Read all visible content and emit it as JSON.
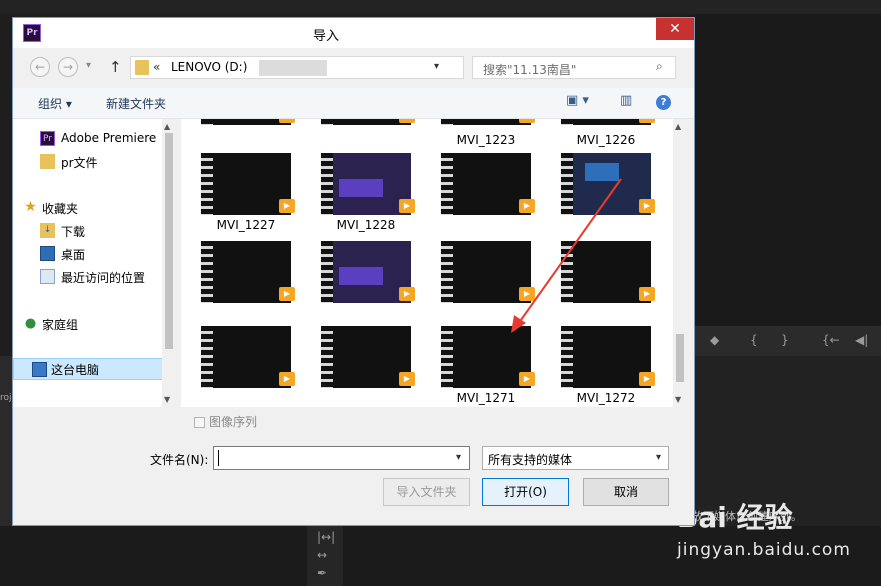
{
  "dialog": {
    "title": "导入",
    "app_icon": "Pr",
    "close_glyph": "✕"
  },
  "nav": {
    "back_glyph": "←",
    "forward_glyph": "→",
    "up_glyph": "↑",
    "address_prefix": "«",
    "address_path": "LENOVO (D:)",
    "search_placeholder": "搜索\"11.13南昌\""
  },
  "toolbar": {
    "organize_label": "组织 ▾",
    "new_folder_label": "新建文件夹"
  },
  "sidebar": {
    "items": [
      {
        "label": "Adobe Premiere",
        "icon": "premiere-icon"
      },
      {
        "label": "pr文件",
        "icon": "folder-icon"
      },
      {
        "label": "收藏夹",
        "icon": "star-icon"
      },
      {
        "label": "下载",
        "icon": "download-folder-icon"
      },
      {
        "label": "桌面",
        "icon": "desktop-icon"
      },
      {
        "label": "最近访问的位置",
        "icon": "recent-places-icon"
      },
      {
        "label": "家庭组",
        "icon": "homegroup-icon"
      },
      {
        "label": "这台电脑",
        "icon": "computer-icon"
      }
    ]
  },
  "files": {
    "row0_labels": [
      "MVI_1223",
      "MVI_1226"
    ],
    "tiles": [
      {
        "name": "MVI_1227"
      },
      {
        "name": "MVI_1228"
      },
      {
        "name": ""
      },
      {
        "name": ""
      },
      {
        "name": ""
      },
      {
        "name": ""
      },
      {
        "name": ""
      },
      {
        "name": ""
      },
      {
        "name": ""
      },
      {
        "name": ""
      },
      {
        "name": "MVI_1271"
      },
      {
        "name": "MVI_1272"
      }
    ]
  },
  "footer": {
    "image_sequence_label": "图像序列",
    "filename_label": "文件名(N):",
    "filename_value": "",
    "filter_value": "所有支持的媒体",
    "import_folder_label": "导入文件夹",
    "open_label": "打开(O)",
    "cancel_label": "取消"
  },
  "background": {
    "left_panel_text": "roj",
    "bottom_right_text": "此处放下媒体以创建序列。",
    "watermark_main": "Bai 经验",
    "watermark_sub": "jingyan.baidu.com"
  }
}
